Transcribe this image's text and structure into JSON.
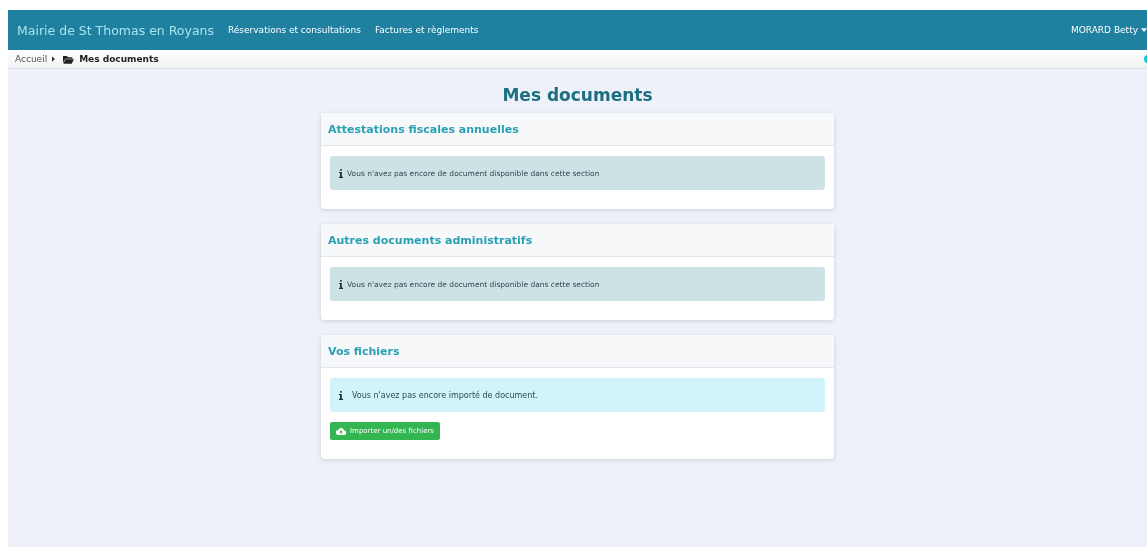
{
  "navbar": {
    "brand": "Mairie de St Thomas en Royans",
    "links": [
      "Réservations et consultations",
      "Factures et règlements"
    ],
    "user": "MORARD Betty"
  },
  "breadcrumb": [
    {
      "label": "Accueil",
      "current": false
    },
    {
      "label": "Mes documents",
      "current": true
    }
  ],
  "page_title": "Mes documents",
  "sections": [
    {
      "title": "Attestations fiscales annuelles",
      "alert": {
        "kind": "secondary",
        "text": "Vous n'avez pas encore de document disponible dans cette section"
      }
    },
    {
      "title": "Autres documents administratifs",
      "alert": {
        "kind": "secondary",
        "text": "Vous n'avez pas encore de document disponible dans cette section"
      }
    },
    {
      "title": "Vos fichiers",
      "alert": {
        "kind": "info",
        "text": "Vous n'avez pas encore importé de document."
      },
      "button": "Importer un/des fichiers"
    }
  ]
}
